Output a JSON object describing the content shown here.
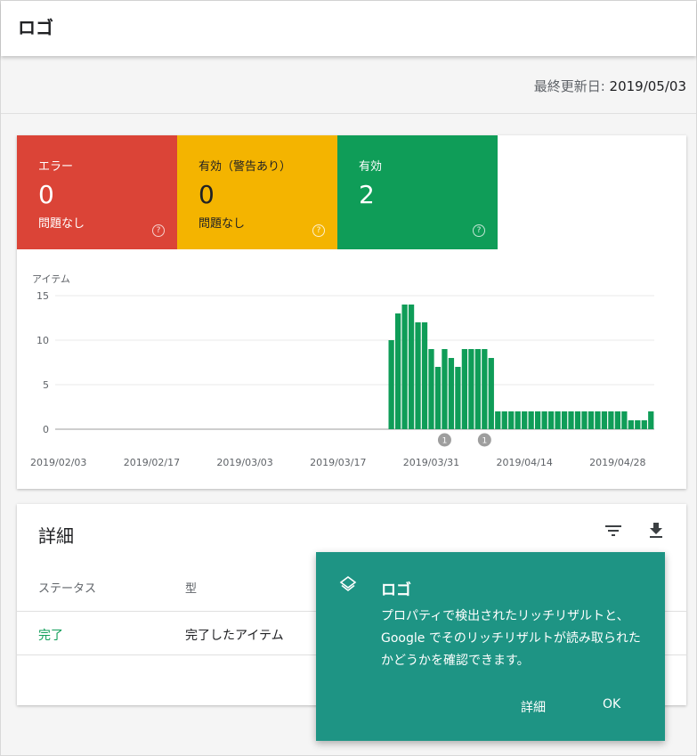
{
  "header": {
    "title": "ロゴ"
  },
  "updated": {
    "label": "最終更新日:",
    "date": "2019/05/03"
  },
  "tiles": [
    {
      "label": "エラー",
      "value": "0",
      "sub": "問題なし",
      "color": "#db4437"
    },
    {
      "label": "有効（警告あり）",
      "value": "0",
      "sub": "問題なし",
      "color": "#f4b400"
    },
    {
      "label": "有効",
      "value": "2",
      "sub": "",
      "color": "#0f9d58"
    }
  ],
  "chart_data": {
    "type": "bar",
    "ylabel": "アイテム",
    "ylim": [
      0,
      15
    ],
    "yticks": [
      0,
      5,
      10,
      15
    ],
    "xtick_labels": [
      "2019/02/03",
      "2019/02/17",
      "2019/03/03",
      "2019/03/17",
      "2019/03/31",
      "2019/04/14",
      "2019/04/28"
    ],
    "x_start": "2019/02/03",
    "x_end": "2019/05/03",
    "bar_color": "#0f9d58",
    "bars": [
      {
        "x": "2019/03/25",
        "y": 10
      },
      {
        "x": "2019/03/26",
        "y": 13
      },
      {
        "x": "2019/03/27",
        "y": 14
      },
      {
        "x": "2019/03/28",
        "y": 14
      },
      {
        "x": "2019/03/29",
        "y": 12
      },
      {
        "x": "2019/03/30",
        "y": 12
      },
      {
        "x": "2019/03/31",
        "y": 9
      },
      {
        "x": "2019/04/01",
        "y": 7
      },
      {
        "x": "2019/04/02",
        "y": 9
      },
      {
        "x": "2019/04/03",
        "y": 8
      },
      {
        "x": "2019/04/04",
        "y": 7
      },
      {
        "x": "2019/04/05",
        "y": 9
      },
      {
        "x": "2019/04/06",
        "y": 9
      },
      {
        "x": "2019/04/07",
        "y": 9
      },
      {
        "x": "2019/04/08",
        "y": 9
      },
      {
        "x": "2019/04/09",
        "y": 8
      },
      {
        "x": "2019/04/10",
        "y": 2
      },
      {
        "x": "2019/04/11",
        "y": 2
      },
      {
        "x": "2019/04/12",
        "y": 2
      },
      {
        "x": "2019/04/13",
        "y": 2
      },
      {
        "x": "2019/04/14",
        "y": 2
      },
      {
        "x": "2019/04/15",
        "y": 2
      },
      {
        "x": "2019/04/16",
        "y": 2
      },
      {
        "x": "2019/04/17",
        "y": 2
      },
      {
        "x": "2019/04/18",
        "y": 2
      },
      {
        "x": "2019/04/19",
        "y": 2
      },
      {
        "x": "2019/04/20",
        "y": 2
      },
      {
        "x": "2019/04/21",
        "y": 2
      },
      {
        "x": "2019/04/22",
        "y": 2
      },
      {
        "x": "2019/04/23",
        "y": 2
      },
      {
        "x": "2019/04/24",
        "y": 2
      },
      {
        "x": "2019/04/25",
        "y": 2
      },
      {
        "x": "2019/04/26",
        "y": 2
      },
      {
        "x": "2019/04/27",
        "y": 2
      },
      {
        "x": "2019/04/28",
        "y": 2
      },
      {
        "x": "2019/04/29",
        "y": 2
      },
      {
        "x": "2019/04/30",
        "y": 1
      },
      {
        "x": "2019/05/01",
        "y": 1
      },
      {
        "x": "2019/05/02",
        "y": 1
      },
      {
        "x": "2019/05/03",
        "y": 2
      }
    ],
    "annotations": [
      {
        "x": "2019/04/02",
        "label": "1"
      },
      {
        "x": "2019/04/08",
        "label": "1"
      }
    ],
    "grid": true
  },
  "details": {
    "title": "詳細",
    "filter_icon": "filter-icon",
    "download_icon": "download-icon",
    "columns": [
      "ステータス",
      "型"
    ],
    "rows": [
      {
        "status": "完了",
        "type": "完了したアイテム"
      }
    ],
    "status_color": "#0f9d58"
  },
  "popup": {
    "icon": "layers-icon",
    "title": "ロゴ",
    "body": "プロパティで検出されたリッチリザルトと、Google でそのリッチリザルトが読み取られたかどうかを確認できます。",
    "buttons": {
      "details": "詳細",
      "ok": "OK"
    }
  }
}
